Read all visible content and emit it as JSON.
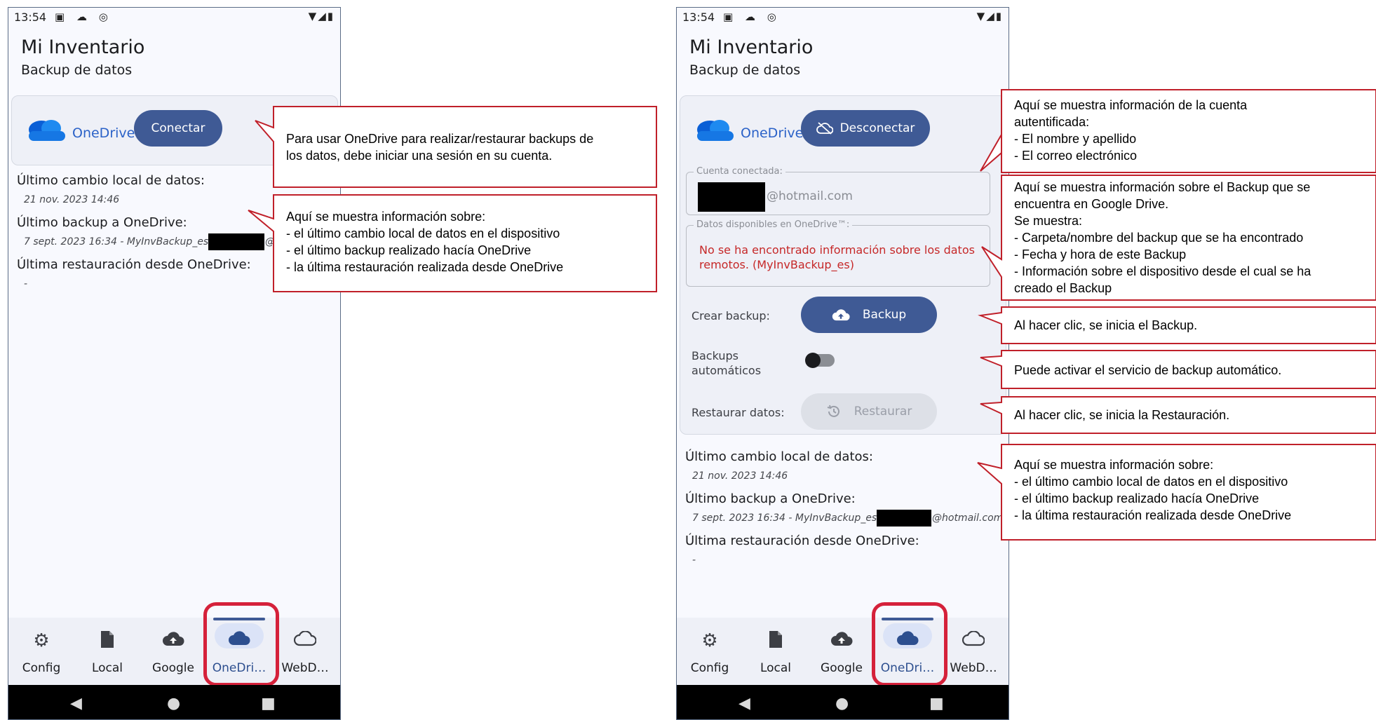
{
  "phone": {
    "status_time": "13:54",
    "status_icons": "▣ ☁ ◎",
    "status_right": "▼◢▮",
    "app_title": "Mi Inventario",
    "app_subtitle": "Backup de datos",
    "onedrive_label": "OneDrive"
  },
  "left": {
    "connect_button": "Conectar",
    "info": {
      "last_local_label": "Último cambio local de datos:",
      "last_local_value": "21 nov. 2023 14:46",
      "last_backup_label": "Último backup a OneDrive:",
      "last_backup_value": "7 sept. 2023 16:34 - MyInvBackup_es - ",
      "last_backup_suffix": "@",
      "last_restore_label": "Última restauración desde OneDrive:",
      "last_restore_value": "-"
    }
  },
  "right": {
    "disconnect_button": "Desconectar",
    "account_legend": "Cuenta conectada:",
    "account_email_suffix": "@hotmail.com",
    "remote_legend": "Datos disponibles en OneDrive™:",
    "remote_error": "No se ha encontrado información sobre los datos remotos. (MyInvBackup_es)",
    "create_backup_label": "Crear backup:",
    "backup_button": "Backup",
    "auto_backups_label": "Backups automáticos",
    "auto_backups_on": false,
    "restore_label": "Restaurar datos:",
    "restore_button": "Restaurar",
    "info": {
      "last_local_label": "Último cambio local de datos:",
      "last_local_value": "21 nov. 2023 14:46",
      "last_backup_label": "Último backup a OneDrive:",
      "last_backup_value": "7 sept. 2023 16:34 - MyInvBackup_es - ",
      "last_backup_suffix": "@hotmail.com",
      "last_restore_label": "Última restauración desde OneDrive:",
      "last_restore_value": "-"
    }
  },
  "nav": {
    "items": [
      {
        "label": "Config",
        "icon": "gear-icon"
      },
      {
        "label": "Local",
        "icon": "file-icon"
      },
      {
        "label": "Google",
        "icon": "cloud-upload-icon"
      },
      {
        "label": "OneDri…",
        "icon": "cloud-filled-icon"
      },
      {
        "label": "WebD…",
        "icon": "cloud-outline-icon"
      }
    ],
    "active_index": 3
  },
  "callouts": {
    "left_connect": "Para usar OneDrive para realizar/restaurar backups de\nlos datos, debe iniciar una sesión en su cuenta.",
    "left_info": "Aquí se muestra información sobre:\n- el último cambio local de datos en el dispositivo\n- el último backup realizado hacía OneDrive\n- la última restauración realizada desde OneDrive",
    "right_account": "Aquí se muestra información de la cuenta\nautentificada:\n- El nombre y apellido\n- El correo electrónico",
    "right_backup_info": "Aquí se muestra información sobre el Backup que se\nencuentra en Google Drive.\nSe muestra:\n- Carpeta/nombre del backup que se ha encontrado\n- Fecha y hora de este Backup\n- Información sobre el dispositivo desde el cual se ha\ncreado el Backup",
    "right_backup_click": "Al hacer clic, se inicia el Backup.",
    "right_auto": "Puede activar el servicio de backup automático.",
    "right_restore": "Al hacer clic, se inicia la Restauración.",
    "right_info": "Aquí se muestra información sobre:\n- el último cambio local de datos en el dispositivo\n- el último backup realizado hacía OneDrive\n- la última restauración realizada desde OneDrive"
  },
  "colors": {
    "accent": "#3f5a95",
    "onedrive_blue": "#2b62c8",
    "highlight_red": "#d5213a",
    "callout_border": "#c0202a",
    "error_red": "#c62828"
  }
}
